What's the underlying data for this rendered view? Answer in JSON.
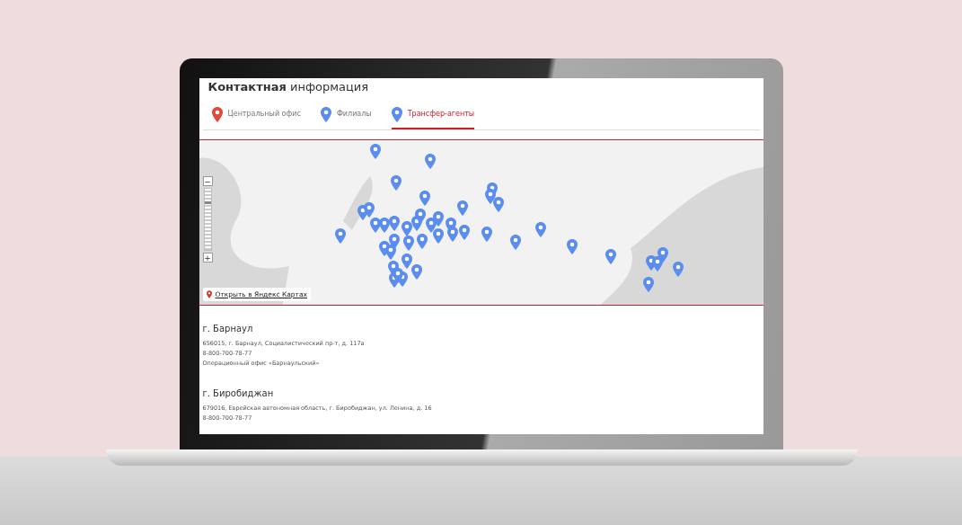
{
  "page_title": "**Контактная** информация",
  "tabs": [
    {
      "label": "Центральный офис",
      "color": "#e04a3a",
      "selected": false
    },
    {
      "label": "Филиалы",
      "color": "#5b8def",
      "selected": false
    },
    {
      "label": "Трансфер-агенты",
      "color": "#5b8def",
      "selected": true
    }
  ],
  "map": {
    "zoom_out": "−",
    "zoom_in": "+",
    "zoom": {
      "level": 0.8
    },
    "open_link": "Открыть в Яндекс Картах"
  },
  "offices": [
    {
      "city": "г. Барнаул",
      "lines": [
        "656015, г. Барнаул, Социалистический пр-т, д. 117а",
        "8-800-700-78-77",
        "Операционный офис «Барнаульский»"
      ]
    },
    {
      "city": "г. Биробиджан",
      "lines": [
        "679016, Еврейская автономная область, г. Биробиджан, ул. Ленина, д. 16",
        "8-800-700-78-77"
      ]
    }
  ]
}
